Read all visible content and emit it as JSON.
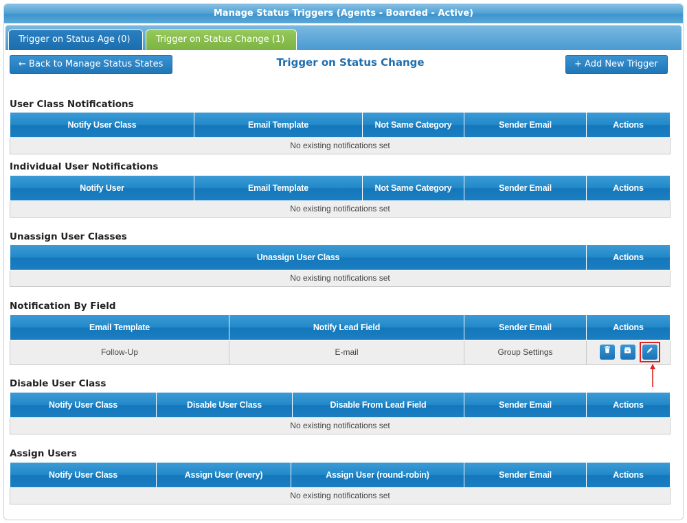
{
  "window": {
    "title": "Manage Status Triggers (Agents - Boarded - Active)"
  },
  "tabs": [
    {
      "label": "Trigger on Status Age (0)"
    },
    {
      "label": "Trigger on Status Change (1)"
    }
  ],
  "toolbar": {
    "back_label": "← Back to Manage Status States",
    "add_label": "+ Add New Trigger",
    "page_title": "Trigger on Status Change"
  },
  "empty_text": "No existing notifications set",
  "sections": {
    "user_class": {
      "title": "User Class Notifications",
      "headers": [
        "Notify User Class",
        "Email Template",
        "Not Same Category",
        "Sender Email",
        "Actions"
      ]
    },
    "individual": {
      "title": "Individual User Notifications",
      "headers": [
        "Notify User",
        "Email Template",
        "Not Same Category",
        "Sender Email",
        "Actions"
      ]
    },
    "unassign": {
      "title": "Unassign User Classes",
      "headers": [
        "Unassign User Class",
        "Actions"
      ]
    },
    "by_field": {
      "title": "Notification By Field",
      "headers": [
        "Email Template",
        "Notify Lead Field",
        "Sender Email",
        "Actions"
      ],
      "rows": [
        {
          "email_template": "Follow-Up",
          "lead_field": "E-mail",
          "sender": "Group Settings"
        }
      ]
    },
    "disable": {
      "title": "Disable User Class",
      "headers": [
        "Notify User Class",
        "Disable User Class",
        "Disable From Lead Field",
        "Sender Email",
        "Actions"
      ]
    },
    "assign": {
      "title": "Assign Users",
      "headers": [
        "Notify User Class",
        "Assign User (every)",
        "Assign User (round-robin)",
        "Sender Email",
        "Actions"
      ]
    }
  },
  "icons": {
    "delete": "trash-icon",
    "archive": "archive-icon",
    "edit": "pencil-icon"
  },
  "colors": {
    "header_blue": "#1f7fc2",
    "active_tab": "#7cb342",
    "title_blue": "#1f6fae",
    "highlight": "#e02020"
  }
}
